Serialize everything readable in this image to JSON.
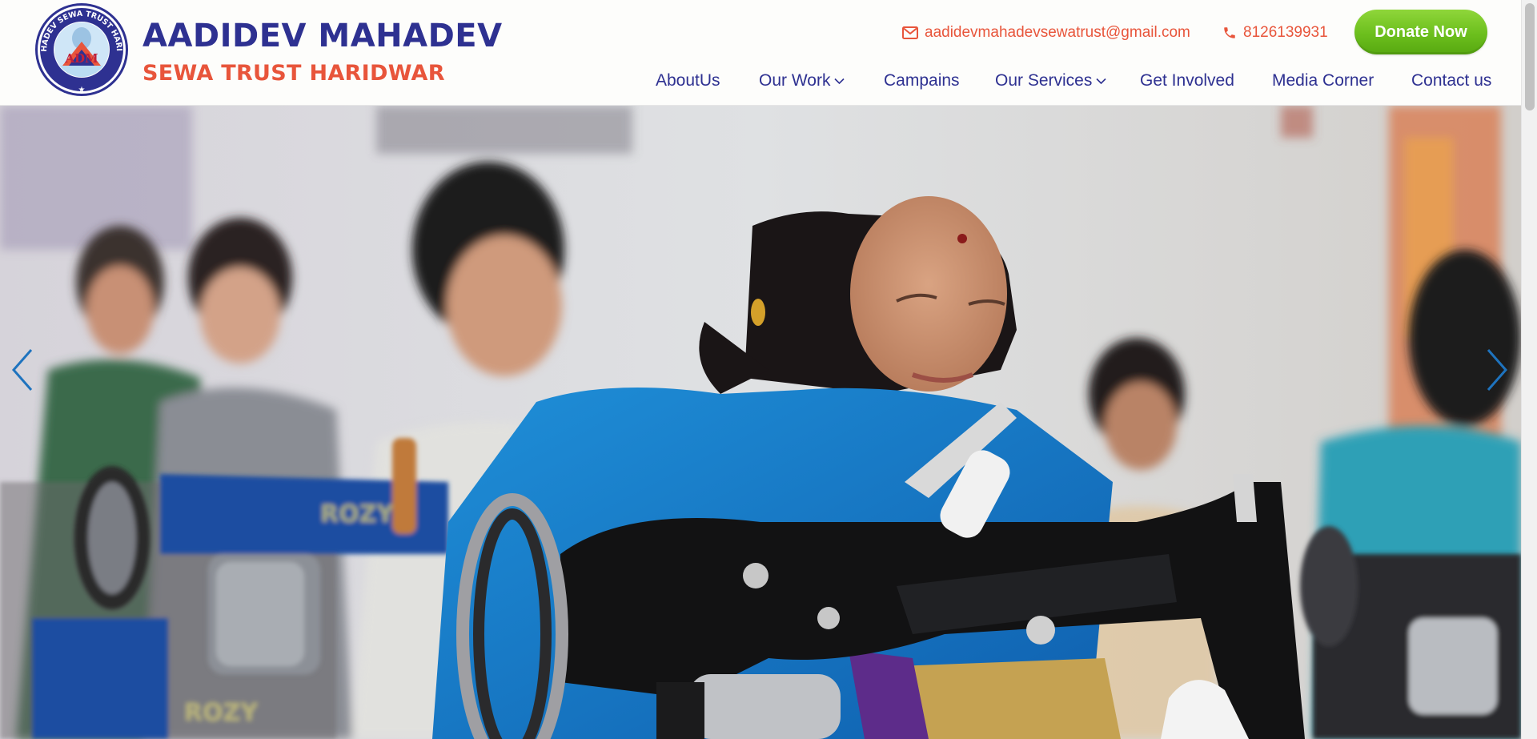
{
  "brand": {
    "emblem_text": "AADIDEV MAHADEV SEWA TRUST HARIDWAR (Reg.)",
    "emblem_initials": "ADM",
    "title": "AADIDEV MAHADEV",
    "subtitle": "SEWA TRUST HARIDWAR"
  },
  "contact": {
    "email": "aadidevmahadevsewatrust@gmail.com",
    "phone": "8126139931"
  },
  "donate_label": "Donate Now",
  "nav": {
    "items": [
      {
        "label": "AboutUs",
        "dropdown": false
      },
      {
        "label": "Our Work",
        "dropdown": true
      },
      {
        "label": "Campains",
        "dropdown": false
      },
      {
        "label": "Our Services",
        "dropdown": true
      },
      {
        "label": "Get Involved",
        "dropdown": false
      },
      {
        "label": "Media Corner",
        "dropdown": false
      },
      {
        "label": "Contact us",
        "dropdown": false
      }
    ]
  },
  "hero": {
    "image_subject": "women-sewing-machines-photo"
  },
  "colors": {
    "brand_blue": "#2e3191",
    "accent_orange": "#e8553b",
    "donate_green": "#6cbf1d",
    "slider_arrow": "#1e73be"
  }
}
